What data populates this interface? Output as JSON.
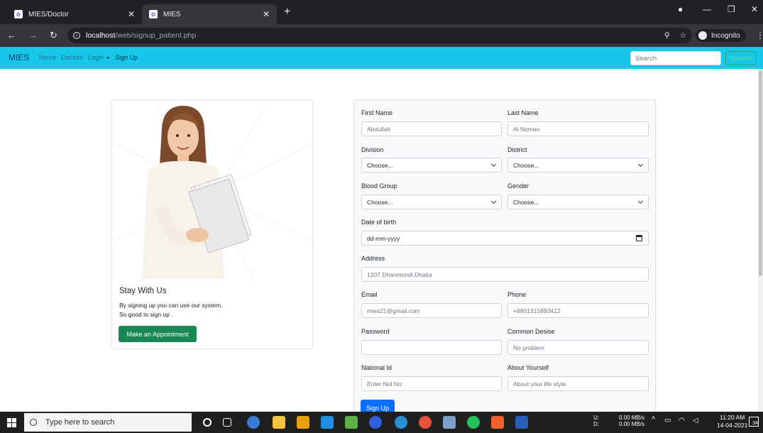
{
  "browser": {
    "tabs": [
      {
        "title": "MIES/Doctor"
      },
      {
        "title": "MIES"
      }
    ],
    "url_host": "localhost",
    "url_path": "/web/signup_patient.php",
    "incognito_label": "Incognito"
  },
  "navbar": {
    "brand": "MIES",
    "links": [
      "Home",
      "Doctors",
      "Login",
      "Sign Up"
    ],
    "search_placeholder": "Search",
    "search_button": "Search"
  },
  "card": {
    "title": "Stay With Us",
    "line1": "By signing up you can use our system.",
    "line2": "So good to sign up .",
    "button": "Make an Appointment"
  },
  "form": {
    "first_name": {
      "label": "First Name",
      "placeholder": "Abdullah"
    },
    "last_name": {
      "label": "Last Name",
      "placeholder": "Al Noman"
    },
    "division": {
      "label": "Division",
      "value": "Choose..."
    },
    "district": {
      "label": "District",
      "value": "Choose..."
    },
    "blood_group": {
      "label": "Blood Group",
      "value": "Choose..."
    },
    "gender": {
      "label": "Gender",
      "value": "Choose..."
    },
    "dob": {
      "label": "Date of birth",
      "value": "dd-mm-yyyy"
    },
    "address": {
      "label": "Address",
      "placeholder": "1207 Dhanmondi,Dhaka"
    },
    "email": {
      "label": "Email",
      "placeholder": "mies21@gmail.com"
    },
    "phone": {
      "label": "Phone",
      "placeholder": "+8801315893412"
    },
    "password": {
      "label": "Password",
      "placeholder": ""
    },
    "common_desise": {
      "label": "Common Desise",
      "placeholder": "No problem"
    },
    "national_id": {
      "label": "National Id",
      "placeholder": "Enter Nid No:"
    },
    "about": {
      "label": "About Yourself",
      "placeholder": "About your life style"
    },
    "submit": "Sign Up"
  },
  "taskbar": {
    "search_placeholder": "Type here to search",
    "net_up": "0.00 MB/s",
    "net_down": "0.00 MB/s",
    "net_up_label": "U:",
    "net_down_label": "D:",
    "time": "11:20 AM",
    "date": "14-04-2021",
    "notifications": "34"
  }
}
